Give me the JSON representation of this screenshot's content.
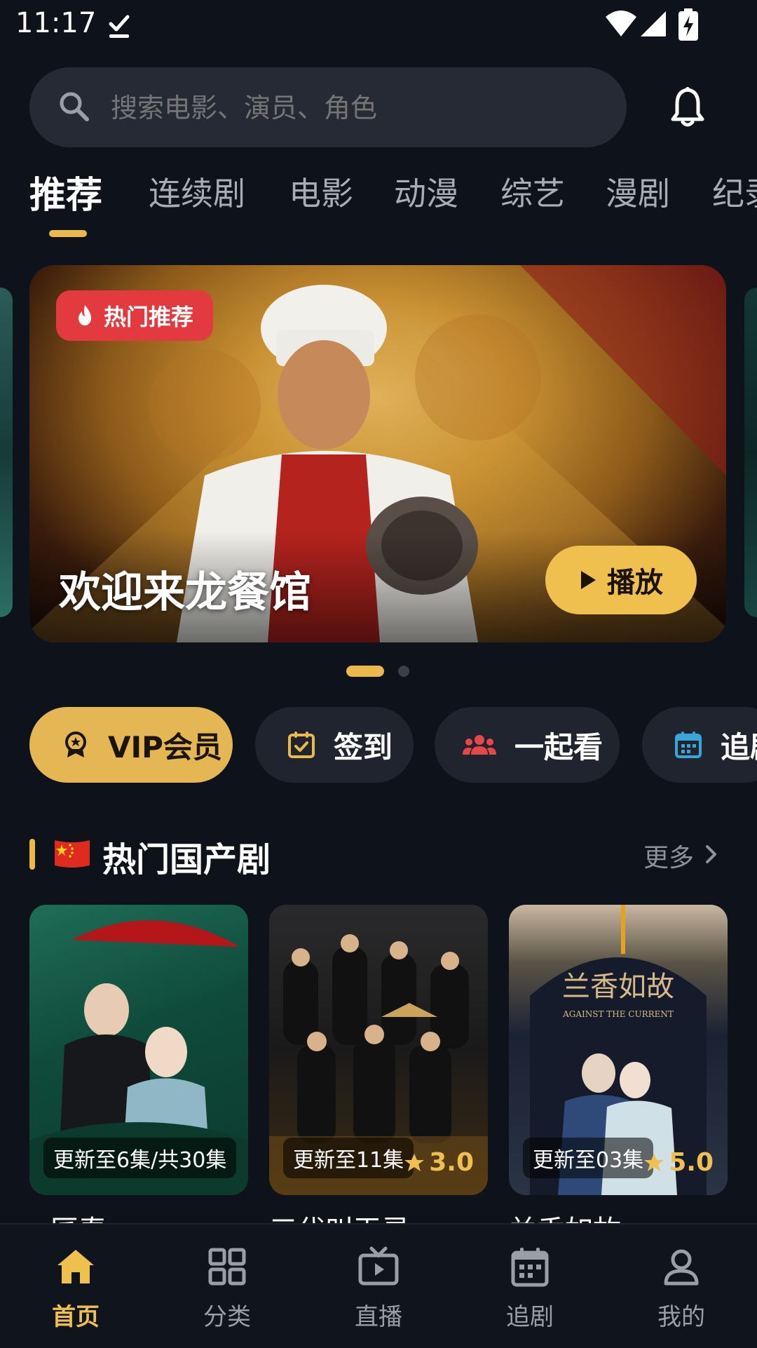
{
  "status_bar": {
    "time": "11:17"
  },
  "search": {
    "placeholder": "搜索电影、演员、角色"
  },
  "tabs": [
    {
      "label": "推荐",
      "active": true
    },
    {
      "label": "连续剧"
    },
    {
      "label": "电影"
    },
    {
      "label": "动漫"
    },
    {
      "label": "综艺"
    },
    {
      "label": "漫剧"
    },
    {
      "label": "纪录"
    }
  ],
  "banner": {
    "badge": "热门推荐",
    "title": "欢迎来龙餐馆",
    "play_label": "播放",
    "page": 1,
    "page_count": 2
  },
  "shortcuts": [
    {
      "label": "VIP会员",
      "icon": "vip-badge-icon"
    },
    {
      "label": "签到",
      "icon": "calendar-check-icon"
    },
    {
      "label": "一起看",
      "icon": "group-icon"
    },
    {
      "label": "追剧",
      "icon": "calendar-icon"
    }
  ],
  "section": {
    "title": "热门国产剧",
    "more": "更多"
  },
  "cards": [
    {
      "status": "更新至6集/共30集",
      "rating": "",
      "title": "匠春"
    },
    {
      "status": "更新至11集",
      "rating": "3.0",
      "title": "三代叫玉灵"
    },
    {
      "status": "更新至03集",
      "rating": "5.0",
      "title": "兰香如故"
    }
  ],
  "bottom_nav": [
    {
      "label": "首页",
      "icon": "home-icon",
      "active": true
    },
    {
      "label": "分类",
      "icon": "grid-icon"
    },
    {
      "label": "直播",
      "icon": "tv-icon"
    },
    {
      "label": "追剧",
      "icon": "calendar-icon"
    },
    {
      "label": "我的",
      "icon": "user-icon"
    }
  ],
  "colors": {
    "accent": "#f0c04f",
    "hot": "#e23a3f",
    "background": "#0e121a"
  }
}
